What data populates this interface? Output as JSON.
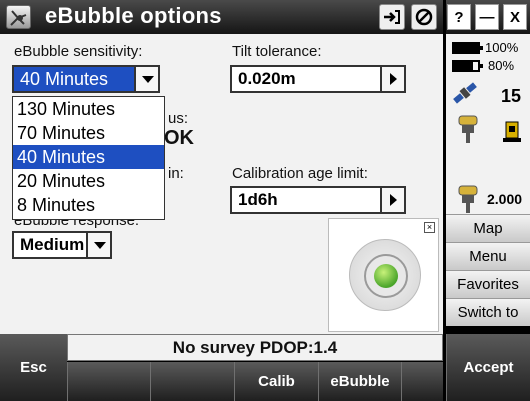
{
  "window": {
    "title": "eBubble options"
  },
  "titlebar_buttons": {
    "help": "?",
    "minimize": "—",
    "close": "X"
  },
  "form": {
    "sensitivity_label": "eBubble sensitivity:",
    "sensitivity_value": "40 Minutes",
    "sensitivity_options": [
      "130 Minutes",
      "70 Minutes",
      "40 Minutes",
      "20 Minutes",
      "8 Minutes"
    ],
    "sensitivity_selected_index": 2,
    "tilt_label": "Tilt tolerance:",
    "tilt_value": "0.020m",
    "partial_label_1": "us:",
    "partial_value_1": "OK",
    "partial_label_2": "in:",
    "calib_label": "Calibration age limit:",
    "calib_value": "1d6h",
    "response_label": "eBubble response:",
    "response_value": "Medium"
  },
  "status": {
    "text": "No survey  PDOP:1.4"
  },
  "softkeys": {
    "esc": "Esc",
    "calib": "Calib",
    "ebubble": "eBubble",
    "accept": "Accept"
  },
  "right_panel": {
    "battery1": "100%",
    "battery1_level": 1.0,
    "battery2": "80%",
    "battery2_level": 0.8,
    "satellites": "15",
    "height": "2.000",
    "menu": [
      "Map",
      "Menu",
      "Favorites",
      "Switch to"
    ]
  },
  "colors": {
    "selection": "#1e4fc1",
    "bubble": "#4aa52a"
  }
}
